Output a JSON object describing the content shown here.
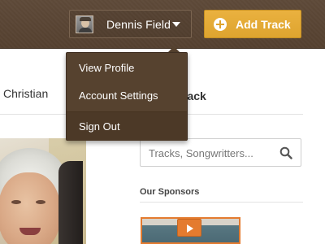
{
  "header": {
    "user": {
      "name": "Dennis Field",
      "avatar_icon": "avatar-photo",
      "caret_icon": "caret-down-icon"
    },
    "add_track": {
      "label": "Add Track",
      "icon": "plus-circle-icon",
      "color": "#E3AA36"
    },
    "background_color": "#5A4636"
  },
  "user_menu": {
    "items": [
      {
        "label": "View Profile"
      },
      {
        "label": "Account Settings"
      },
      {
        "label": "Sign Out"
      }
    ]
  },
  "nav": {
    "genre_label": "Christian"
  },
  "main": {
    "track_heading": "rack"
  },
  "sidebar": {
    "search": {
      "placeholder": "Tracks, Songwritters...",
      "value": "",
      "icon": "search-icon"
    },
    "sponsors": {
      "title": "Our Sponsors",
      "thumb_icon": "play-icon",
      "accent_color": "#E47B2F"
    }
  }
}
